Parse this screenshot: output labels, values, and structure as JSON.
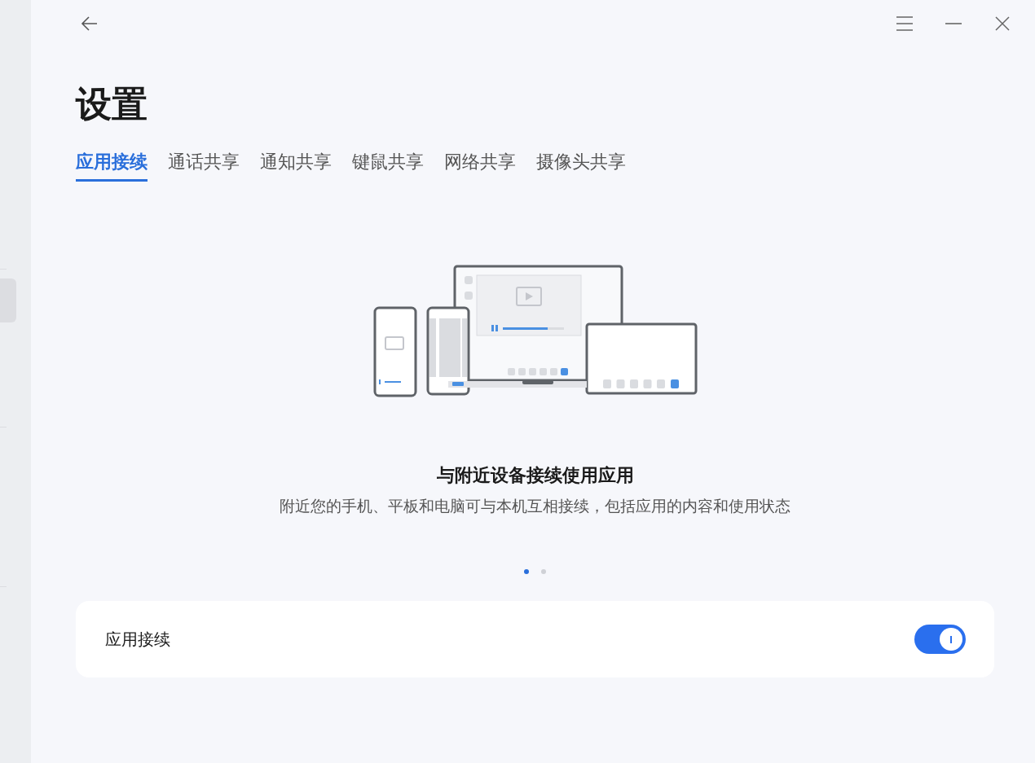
{
  "title": "设置",
  "tabs": [
    {
      "label": "应用接续",
      "selected": true
    },
    {
      "label": "通话共享",
      "selected": false
    },
    {
      "label": "通知共享",
      "selected": false
    },
    {
      "label": "键鼠共享",
      "selected": false
    },
    {
      "label": "网络共享",
      "selected": false
    },
    {
      "label": "摄像头共享",
      "selected": false
    }
  ],
  "feature": {
    "heading": "与附近设备接续使用应用",
    "description": "附近您的手机、平板和电脑可与本机互相接续，包括应用的内容和使用状态"
  },
  "pager": [
    {
      "selected": true
    },
    {
      "selected": false
    }
  ],
  "setting": {
    "label": "应用接续",
    "on": true
  }
}
